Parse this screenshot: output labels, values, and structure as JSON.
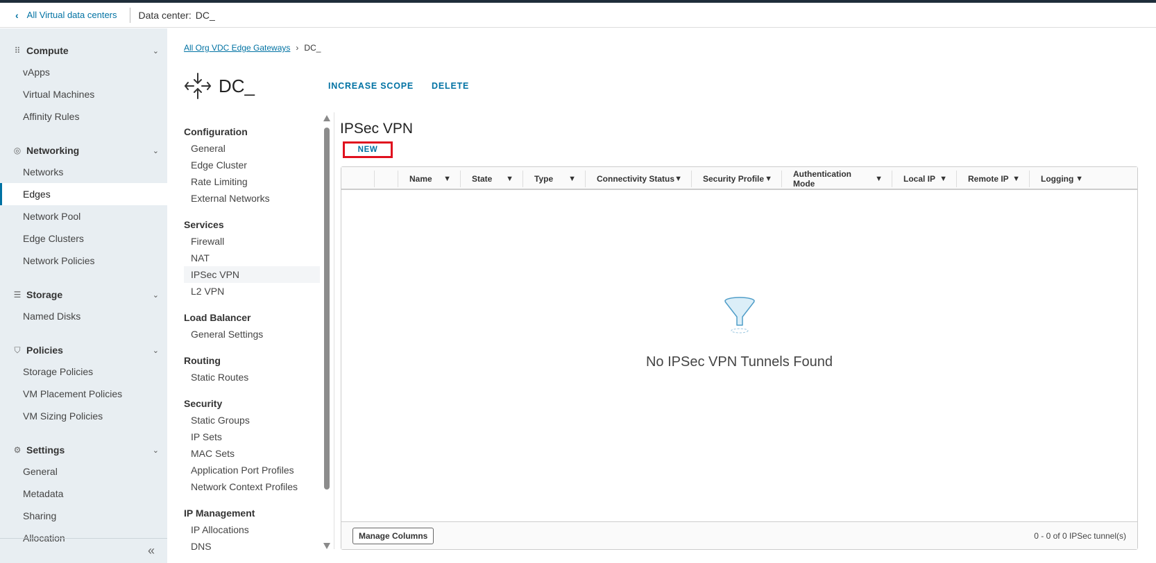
{
  "header": {
    "back_label": "All Virtual data centers",
    "dc_label": "Data center:",
    "dc_name": "DC_"
  },
  "sidebar": {
    "sections": [
      {
        "title": "Compute",
        "icon": "grid-icon",
        "items": [
          "vApps",
          "Virtual Machines",
          "Affinity Rules"
        ]
      },
      {
        "title": "Networking",
        "icon": "network-icon",
        "items": [
          "Networks",
          "Edges",
          "Network Pool",
          "Edge Clusters",
          "Network Policies"
        ]
      },
      {
        "title": "Storage",
        "icon": "database-icon",
        "items": [
          "Named Disks"
        ]
      },
      {
        "title": "Policies",
        "icon": "shield-icon",
        "items": [
          "Storage Policies",
          "VM Placement Policies",
          "VM Sizing Policies"
        ]
      },
      {
        "title": "Settings",
        "icon": "gear-icon",
        "items": [
          "General",
          "Metadata",
          "Sharing",
          "Allocation"
        ]
      }
    ],
    "active_item": "Edges"
  },
  "breadcrumb": {
    "link": "All Org VDC Edge Gateways",
    "current": "DC_"
  },
  "gateway": {
    "title": "DC_",
    "actions": [
      "INCREASE SCOPE",
      "DELETE"
    ]
  },
  "subnav": {
    "groups": [
      {
        "title": "Configuration",
        "items": [
          "General",
          "Edge Cluster",
          "Rate Limiting",
          "External Networks"
        ]
      },
      {
        "title": "Services",
        "items": [
          "Firewall",
          "NAT",
          "IPSec VPN",
          "L2 VPN"
        ]
      },
      {
        "title": "Load Balancer",
        "items": [
          "General Settings"
        ]
      },
      {
        "title": "Routing",
        "items": [
          "Static Routes"
        ]
      },
      {
        "title": "Security",
        "items": [
          "Static Groups",
          "IP Sets",
          "MAC Sets",
          "Application Port Profiles",
          "Network Context Profiles"
        ]
      },
      {
        "title": "IP Management",
        "items": [
          "IP Allocations",
          "DNS"
        ]
      }
    ],
    "active_item": "IPSec VPN"
  },
  "content": {
    "title": "IPSec VPN",
    "new_label": "NEW",
    "columns": [
      "Name",
      "State",
      "Type",
      "Connectivity Status",
      "Security Profile",
      "Authentication Mode",
      "Local IP",
      "Remote IP",
      "Logging"
    ],
    "empty_message": "No IPSec VPN Tunnels Found",
    "manage_columns": "Manage Columns",
    "footer_count": "0 - 0 of 0 IPSec tunnel(s)"
  }
}
